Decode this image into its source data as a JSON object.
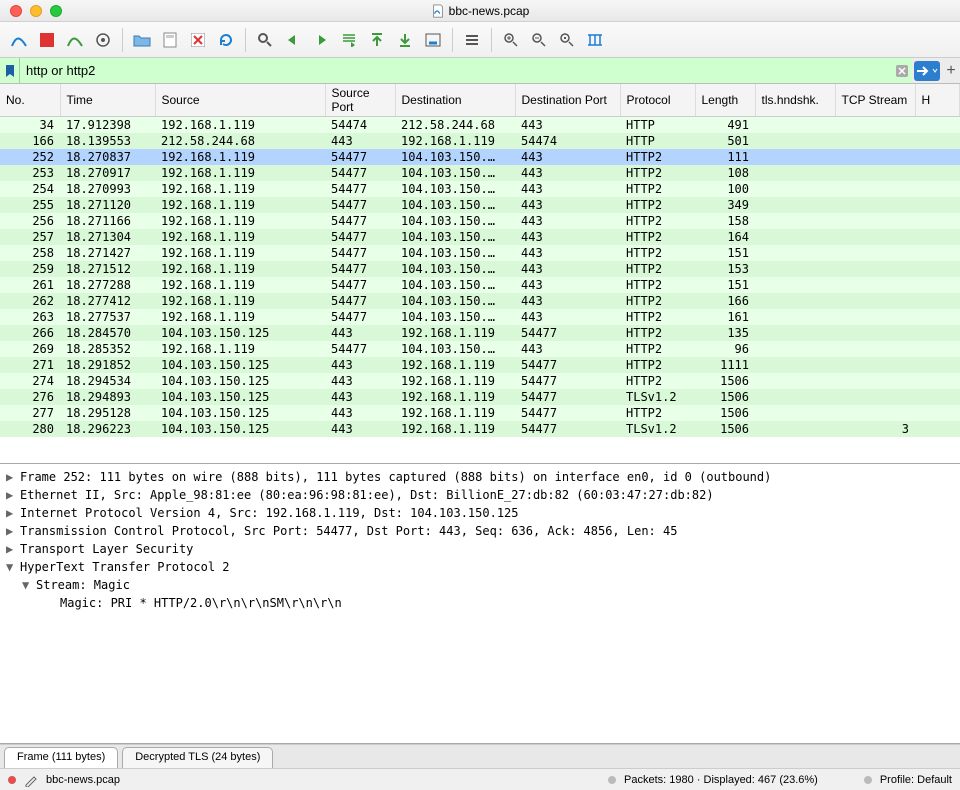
{
  "title": "bbc-news.pcap",
  "filter": {
    "value": "http or http2"
  },
  "columns": [
    "No.",
    "Time",
    "Source",
    "Source Port",
    "Destination",
    "Destination Port",
    "Protocol",
    "Length",
    "tls.hndshk.",
    "TCP Stream",
    "H"
  ],
  "packets": [
    {
      "no": 34,
      "time": "17.912398",
      "src": "192.168.1.119",
      "sport": "54474",
      "dst": "212.58.244.68",
      "dport": "443",
      "proto": "HTTP",
      "len": 491,
      "hnd": "",
      "stream": ""
    },
    {
      "no": 166,
      "time": "18.139553",
      "src": "212.58.244.68",
      "sport": "443",
      "dst": "192.168.1.119",
      "dport": "54474",
      "proto": "HTTP",
      "len": 501,
      "hnd": "",
      "stream": ""
    },
    {
      "no": 252,
      "time": "18.270837",
      "src": "192.168.1.119",
      "sport": "54477",
      "dst": "104.103.150.…",
      "dport": "443",
      "proto": "HTTP2",
      "len": 111,
      "hnd": "",
      "stream": "",
      "selected": true
    },
    {
      "no": 253,
      "time": "18.270917",
      "src": "192.168.1.119",
      "sport": "54477",
      "dst": "104.103.150.…",
      "dport": "443",
      "proto": "HTTP2",
      "len": 108,
      "hnd": "",
      "stream": ""
    },
    {
      "no": 254,
      "time": "18.270993",
      "src": "192.168.1.119",
      "sport": "54477",
      "dst": "104.103.150.…",
      "dport": "443",
      "proto": "HTTP2",
      "len": 100,
      "hnd": "",
      "stream": ""
    },
    {
      "no": 255,
      "time": "18.271120",
      "src": "192.168.1.119",
      "sport": "54477",
      "dst": "104.103.150.…",
      "dport": "443",
      "proto": "HTTP2",
      "len": 349,
      "hnd": "",
      "stream": ""
    },
    {
      "no": 256,
      "time": "18.271166",
      "src": "192.168.1.119",
      "sport": "54477",
      "dst": "104.103.150.…",
      "dport": "443",
      "proto": "HTTP2",
      "len": 158,
      "hnd": "",
      "stream": ""
    },
    {
      "no": 257,
      "time": "18.271304",
      "src": "192.168.1.119",
      "sport": "54477",
      "dst": "104.103.150.…",
      "dport": "443",
      "proto": "HTTP2",
      "len": 164,
      "hnd": "",
      "stream": ""
    },
    {
      "no": 258,
      "time": "18.271427",
      "src": "192.168.1.119",
      "sport": "54477",
      "dst": "104.103.150.…",
      "dport": "443",
      "proto": "HTTP2",
      "len": 151,
      "hnd": "",
      "stream": ""
    },
    {
      "no": 259,
      "time": "18.271512",
      "src": "192.168.1.119",
      "sport": "54477",
      "dst": "104.103.150.…",
      "dport": "443",
      "proto": "HTTP2",
      "len": 153,
      "hnd": "",
      "stream": ""
    },
    {
      "no": 261,
      "time": "18.277288",
      "src": "192.168.1.119",
      "sport": "54477",
      "dst": "104.103.150.…",
      "dport": "443",
      "proto": "HTTP2",
      "len": 151,
      "hnd": "",
      "stream": ""
    },
    {
      "no": 262,
      "time": "18.277412",
      "src": "192.168.1.119",
      "sport": "54477",
      "dst": "104.103.150.…",
      "dport": "443",
      "proto": "HTTP2",
      "len": 166,
      "hnd": "",
      "stream": ""
    },
    {
      "no": 263,
      "time": "18.277537",
      "src": "192.168.1.119",
      "sport": "54477",
      "dst": "104.103.150.…",
      "dport": "443",
      "proto": "HTTP2",
      "len": 161,
      "hnd": "",
      "stream": ""
    },
    {
      "no": 266,
      "time": "18.284570",
      "src": "104.103.150.125",
      "sport": "443",
      "dst": "192.168.1.119",
      "dport": "54477",
      "proto": "HTTP2",
      "len": 135,
      "hnd": "",
      "stream": ""
    },
    {
      "no": 269,
      "time": "18.285352",
      "src": "192.168.1.119",
      "sport": "54477",
      "dst": "104.103.150.…",
      "dport": "443",
      "proto": "HTTP2",
      "len": 96,
      "hnd": "",
      "stream": ""
    },
    {
      "no": 271,
      "time": "18.291852",
      "src": "104.103.150.125",
      "sport": "443",
      "dst": "192.168.1.119",
      "dport": "54477",
      "proto": "HTTP2",
      "len": 1111,
      "hnd": "",
      "stream": ""
    },
    {
      "no": 274,
      "time": "18.294534",
      "src": "104.103.150.125",
      "sport": "443",
      "dst": "192.168.1.119",
      "dport": "54477",
      "proto": "HTTP2",
      "len": 1506,
      "hnd": "",
      "stream": ""
    },
    {
      "no": 276,
      "time": "18.294893",
      "src": "104.103.150.125",
      "sport": "443",
      "dst": "192.168.1.119",
      "dport": "54477",
      "proto": "TLSv1.2",
      "len": 1506,
      "hnd": "",
      "stream": ""
    },
    {
      "no": 277,
      "time": "18.295128",
      "src": "104.103.150.125",
      "sport": "443",
      "dst": "192.168.1.119",
      "dport": "54477",
      "proto": "HTTP2",
      "len": 1506,
      "hnd": "",
      "stream": ""
    },
    {
      "no": 280,
      "time": "18.296223",
      "src": "104.103.150.125",
      "sport": "443",
      "dst": "192.168.1.119",
      "dport": "54477",
      "proto": "TLSv1.2",
      "len": 1506,
      "hnd": "",
      "stream": "3"
    }
  ],
  "details": [
    {
      "expand": "closed",
      "indent": 0,
      "text": "Frame 252: 111 bytes on wire (888 bits), 111 bytes captured (888 bits) on interface en0, id 0 (outbound)"
    },
    {
      "expand": "closed",
      "indent": 0,
      "text": "Ethernet II, Src: Apple_98:81:ee (80:ea:96:98:81:ee), Dst: BillionE_27:db:82 (60:03:47:27:db:82)"
    },
    {
      "expand": "closed",
      "indent": 0,
      "text": "Internet Protocol Version 4, Src: 192.168.1.119, Dst: 104.103.150.125"
    },
    {
      "expand": "closed",
      "indent": 0,
      "text": "Transmission Control Protocol, Src Port: 54477, Dst Port: 443, Seq: 636, Ack: 4856, Len: 45"
    },
    {
      "expand": "closed",
      "indent": 0,
      "text": "Transport Layer Security"
    },
    {
      "expand": "open",
      "indent": 0,
      "text": "HyperText Transfer Protocol 2"
    },
    {
      "expand": "open",
      "indent": 1,
      "text": "Stream: Magic"
    },
    {
      "expand": "none",
      "indent": 2,
      "text": "Magic: PRI * HTTP/2.0\\r\\n\\r\\nSM\\r\\n\\r\\n"
    }
  ],
  "tabs": [
    {
      "label": "Frame (111 bytes)",
      "active": true
    },
    {
      "label": "Decrypted TLS (24 bytes)"
    }
  ],
  "status": {
    "file": "bbc-news.pcap",
    "center": "Packets: 1980 · Displayed: 467 (23.6%)",
    "right": "Profile: Default"
  }
}
